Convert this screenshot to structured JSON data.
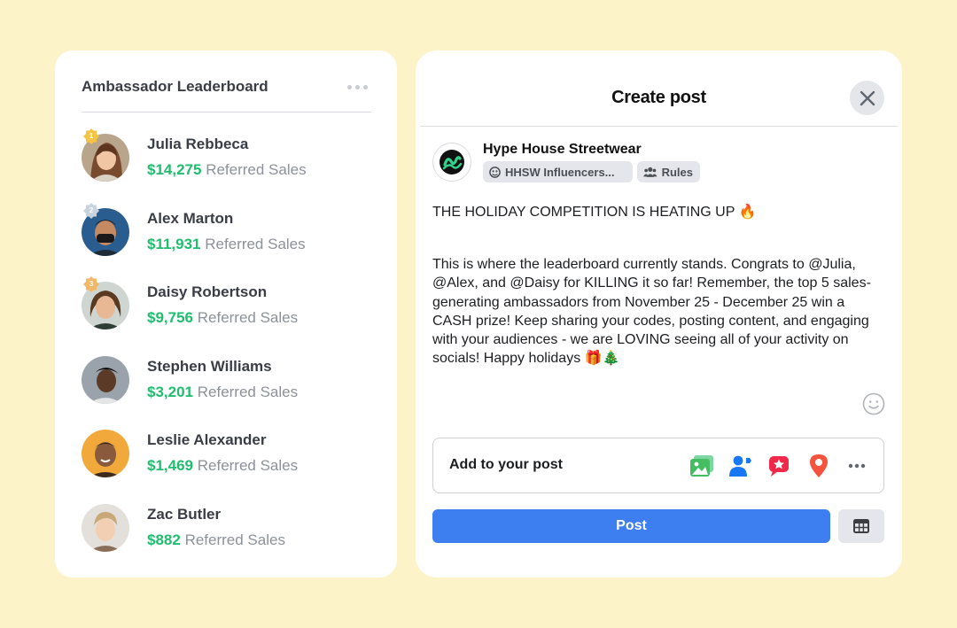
{
  "leaderboard": {
    "title": "Ambassador Leaderboard",
    "more_icon": "more-horizontal-icon",
    "sales_suffix": "Referred Sales",
    "items": [
      {
        "rank": "1",
        "name": "Julia Rebbeca",
        "amount": "$14,275"
      },
      {
        "rank": "2",
        "name": "Alex Marton",
        "amount": "$11,931"
      },
      {
        "rank": "3",
        "name": "Daisy Robertson",
        "amount": "$9,756"
      },
      {
        "name": "Stephen Williams",
        "amount": "$3,201"
      },
      {
        "name": "Leslie Alexander",
        "amount": "$1,469"
      },
      {
        "name": "Zac Butler",
        "amount": "$882"
      }
    ]
  },
  "post": {
    "title": "Create post",
    "close_icon": "close-icon",
    "page_name": "Hype House Streetwear",
    "audience_label": "HHSW Influencers...",
    "rules_label": "Rules",
    "headline": "THE HOLIDAY COMPETITION IS HEATING UP 🔥",
    "body": "This is where the leaderboard currently stands. Congrats to @Julia, @Alex, and @Daisy for KILLING it so far! Remember, the top 5 sales-generating ambassadors from November 25 - December 25 win a CASH prize! Keep sharing your codes, posting content, and engaging with your audiences - we are LOVING seeing all of your activity on socials! Happy holidays 🎁🎄",
    "add_to_post_label": "Add to your post",
    "add_icons": [
      "photo-video-icon",
      "tag-people-icon",
      "feeling-icon",
      "check-in-icon",
      "more-icon"
    ],
    "post_button": "Post",
    "schedule_icon": "calendar-icon"
  },
  "colors": {
    "background": "#fcf3c9",
    "amount_green": "#1fbd6e",
    "post_blue": "#3d7ef0",
    "gold_badge": "#f5c542",
    "silver_badge": "#c9d3de",
    "bronze_badge": "#f2b868"
  }
}
